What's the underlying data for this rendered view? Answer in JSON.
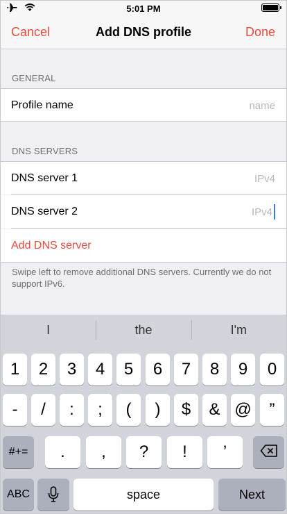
{
  "status_bar": {
    "time": "5:01 PM",
    "icons": [
      "airplane-icon",
      "wifi-icon",
      "battery-icon"
    ]
  },
  "nav": {
    "cancel_label": "Cancel",
    "title": "Add DNS profile",
    "done_label": "Done"
  },
  "general": {
    "header": "GENERAL",
    "profile_name_label": "Profile name",
    "profile_name_placeholder": "name",
    "profile_name_value": ""
  },
  "dns_servers": {
    "header": "DNS SERVERS",
    "servers": [
      {
        "label": "DNS server 1",
        "placeholder": "IPv4",
        "value": ""
      },
      {
        "label": "DNS server 2",
        "placeholder": "IPv4",
        "value": ""
      }
    ],
    "add_label": "Add DNS server",
    "footer_note": "Swipe left to remove additional DNS servers. Currently we do not support IPv6."
  },
  "keyboard": {
    "suggestions": [
      "I",
      "the",
      "I'm"
    ],
    "row1": [
      "1",
      "2",
      "3",
      "4",
      "5",
      "6",
      "7",
      "8",
      "9",
      "0"
    ],
    "row2": [
      "-",
      "/",
      ":",
      ";",
      "(",
      ")",
      "$",
      "&",
      "@",
      "”"
    ],
    "row3": {
      "shift_label": "#+=",
      "keys": [
        ".",
        ",",
        "?",
        "!",
        "’"
      ],
      "backspace_icon": "backspace-icon"
    },
    "row4": {
      "abc_label": "ABC",
      "mic_icon": "microphone-icon",
      "space_label": "space",
      "next_label": "Next"
    }
  },
  "colors": {
    "accent": "#e84b3c",
    "background": "#efeff4",
    "keyboard": "#d1d4da",
    "caret": "#3478f6"
  }
}
